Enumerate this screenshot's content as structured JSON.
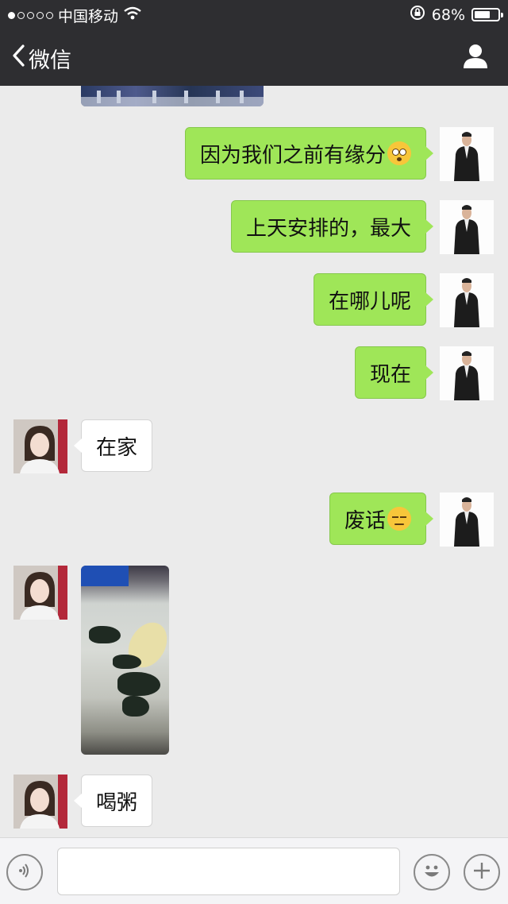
{
  "status_bar": {
    "carrier": "中国移动",
    "signal_dots_filled": 1,
    "signal_dots_total": 5,
    "battery_percent": "68%",
    "battery_level": 0.68
  },
  "nav": {
    "back_label": "微信"
  },
  "messages": [
    {
      "from": "me",
      "text": "因为我们之前有缘分",
      "emoji": "flushed-face"
    },
    {
      "from": "me",
      "text": "上天安排的，最大"
    },
    {
      "from": "me",
      "text": "在哪儿呢"
    },
    {
      "from": "me",
      "text": "现在"
    },
    {
      "from": "her",
      "text": "在家"
    },
    {
      "from": "me",
      "text": "废话",
      "emoji": "unamused-face"
    },
    {
      "from": "her",
      "type": "image",
      "content": "porridge-photo"
    },
    {
      "from": "her",
      "text": "喝粥"
    }
  ],
  "input": {
    "value": "",
    "icons": [
      "voice-icon",
      "emoji-icon",
      "plus-icon"
    ]
  },
  "colors": {
    "header_bg": "#2e2e31",
    "chat_bg": "#ebebeb",
    "my_bubble": "#9fe658",
    "her_bubble": "#ffffff"
  }
}
